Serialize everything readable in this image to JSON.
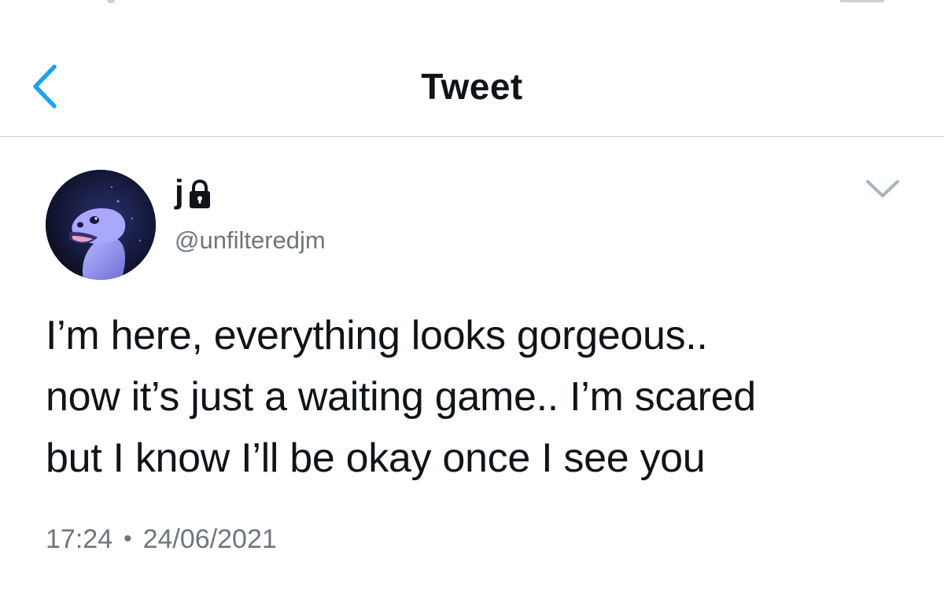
{
  "header": {
    "title": "Tweet",
    "back_icon": "chevron-left-icon",
    "accent_color": "#1da1f2"
  },
  "tweet": {
    "author": {
      "display_name": "j",
      "protected_icon": "lock-icon",
      "handle": "@unfilteredjm",
      "avatar_icon": "avatar-image"
    },
    "menu_icon": "chevron-down-icon",
    "text": "I’m here, everything looks gorgeous..\nnow it’s just a waiting game.. I’m scared\nbut I know I’ll be okay once I see you",
    "time": "17:24",
    "separator": "•",
    "date": "24/06/2021"
  },
  "colors": {
    "text_primary": "#0f1419",
    "text_secondary": "#6e767d",
    "divider": "#cfd3d6"
  }
}
